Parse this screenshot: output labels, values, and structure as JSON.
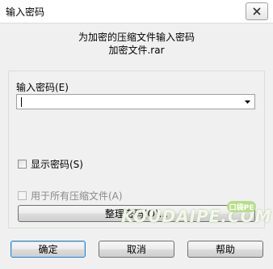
{
  "window": {
    "title": "输入密码",
    "close_icon": "close-icon"
  },
  "header": {
    "line1": "为加密的压缩文件输入密码",
    "line2": "加密文件.rar"
  },
  "password": {
    "label": "输入密码(E)",
    "value": ""
  },
  "show_password": {
    "label": "显示密码(S)",
    "checked": false
  },
  "use_for_all": {
    "label": "用于所有压缩文件(A)",
    "checked": false,
    "enabled": false
  },
  "organize_button": {
    "label": "整理密码(O)..."
  },
  "buttons": {
    "ok": "确定",
    "cancel": "取消",
    "help": "帮助"
  },
  "watermark": {
    "text": "KOUDAIPE.COM",
    "badge": "口袋PE"
  }
}
